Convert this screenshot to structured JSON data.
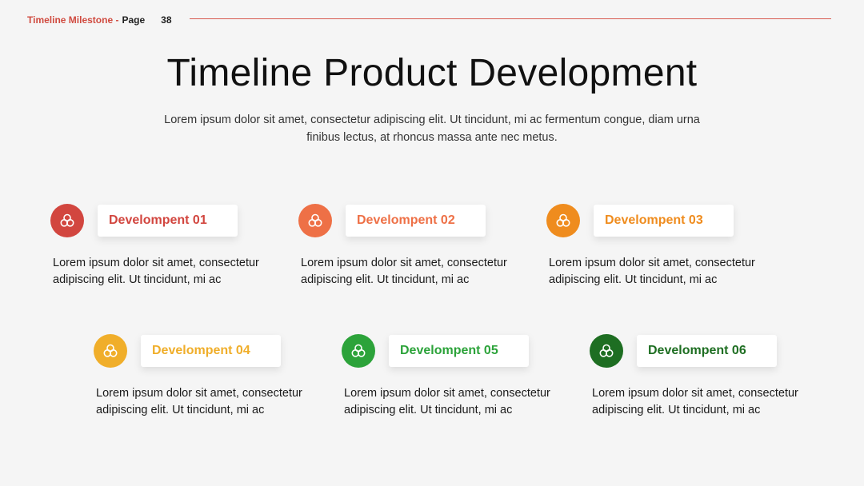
{
  "header": {
    "brand": "Timeline Milestone -",
    "page_label": "Page",
    "page_number": "38"
  },
  "title": "Timeline Product Development",
  "subtitle": "Lorem ipsum dolor sit amet, consectetur adipiscing elit. Ut tincidunt, mi ac fermentum congue, diam urna finibus lectus, at rhoncus massa ante nec metus.",
  "items": [
    {
      "label": "Develompent 01",
      "description": "Lorem ipsum dolor sit amet, consectetur adipiscing elit. Ut tincidunt, mi ac",
      "color": "#d2463f",
      "icon": "group-icon"
    },
    {
      "label": "Develompent 02",
      "description": "Lorem ipsum dolor sit amet, consectetur adipiscing elit. Ut tincidunt, mi ac",
      "color": "#ee7046",
      "icon": "group-icon"
    },
    {
      "label": "Develompent 03",
      "description": "Lorem ipsum dolor sit amet, consectetur adipiscing elit. Ut tincidunt, mi ac",
      "color": "#ef8c1e",
      "icon": "group-icon"
    },
    {
      "label": "Develompent 04",
      "description": "Lorem ipsum dolor sit amet, consectetur adipiscing elit. Ut tincidunt, mi ac",
      "color": "#f0ae2a",
      "icon": "group-icon"
    },
    {
      "label": "Develompent 05",
      "description": "Lorem ipsum dolor sit amet, consectetur adipiscing elit. Ut tincidunt, mi ac",
      "color": "#2ca33a",
      "icon": "group-icon"
    },
    {
      "label": "Develompent 06",
      "description": "Lorem ipsum dolor sit amet, consectetur adipiscing elit. Ut tincidunt, mi ac",
      "color": "#1e6e22",
      "icon": "group-icon"
    }
  ]
}
